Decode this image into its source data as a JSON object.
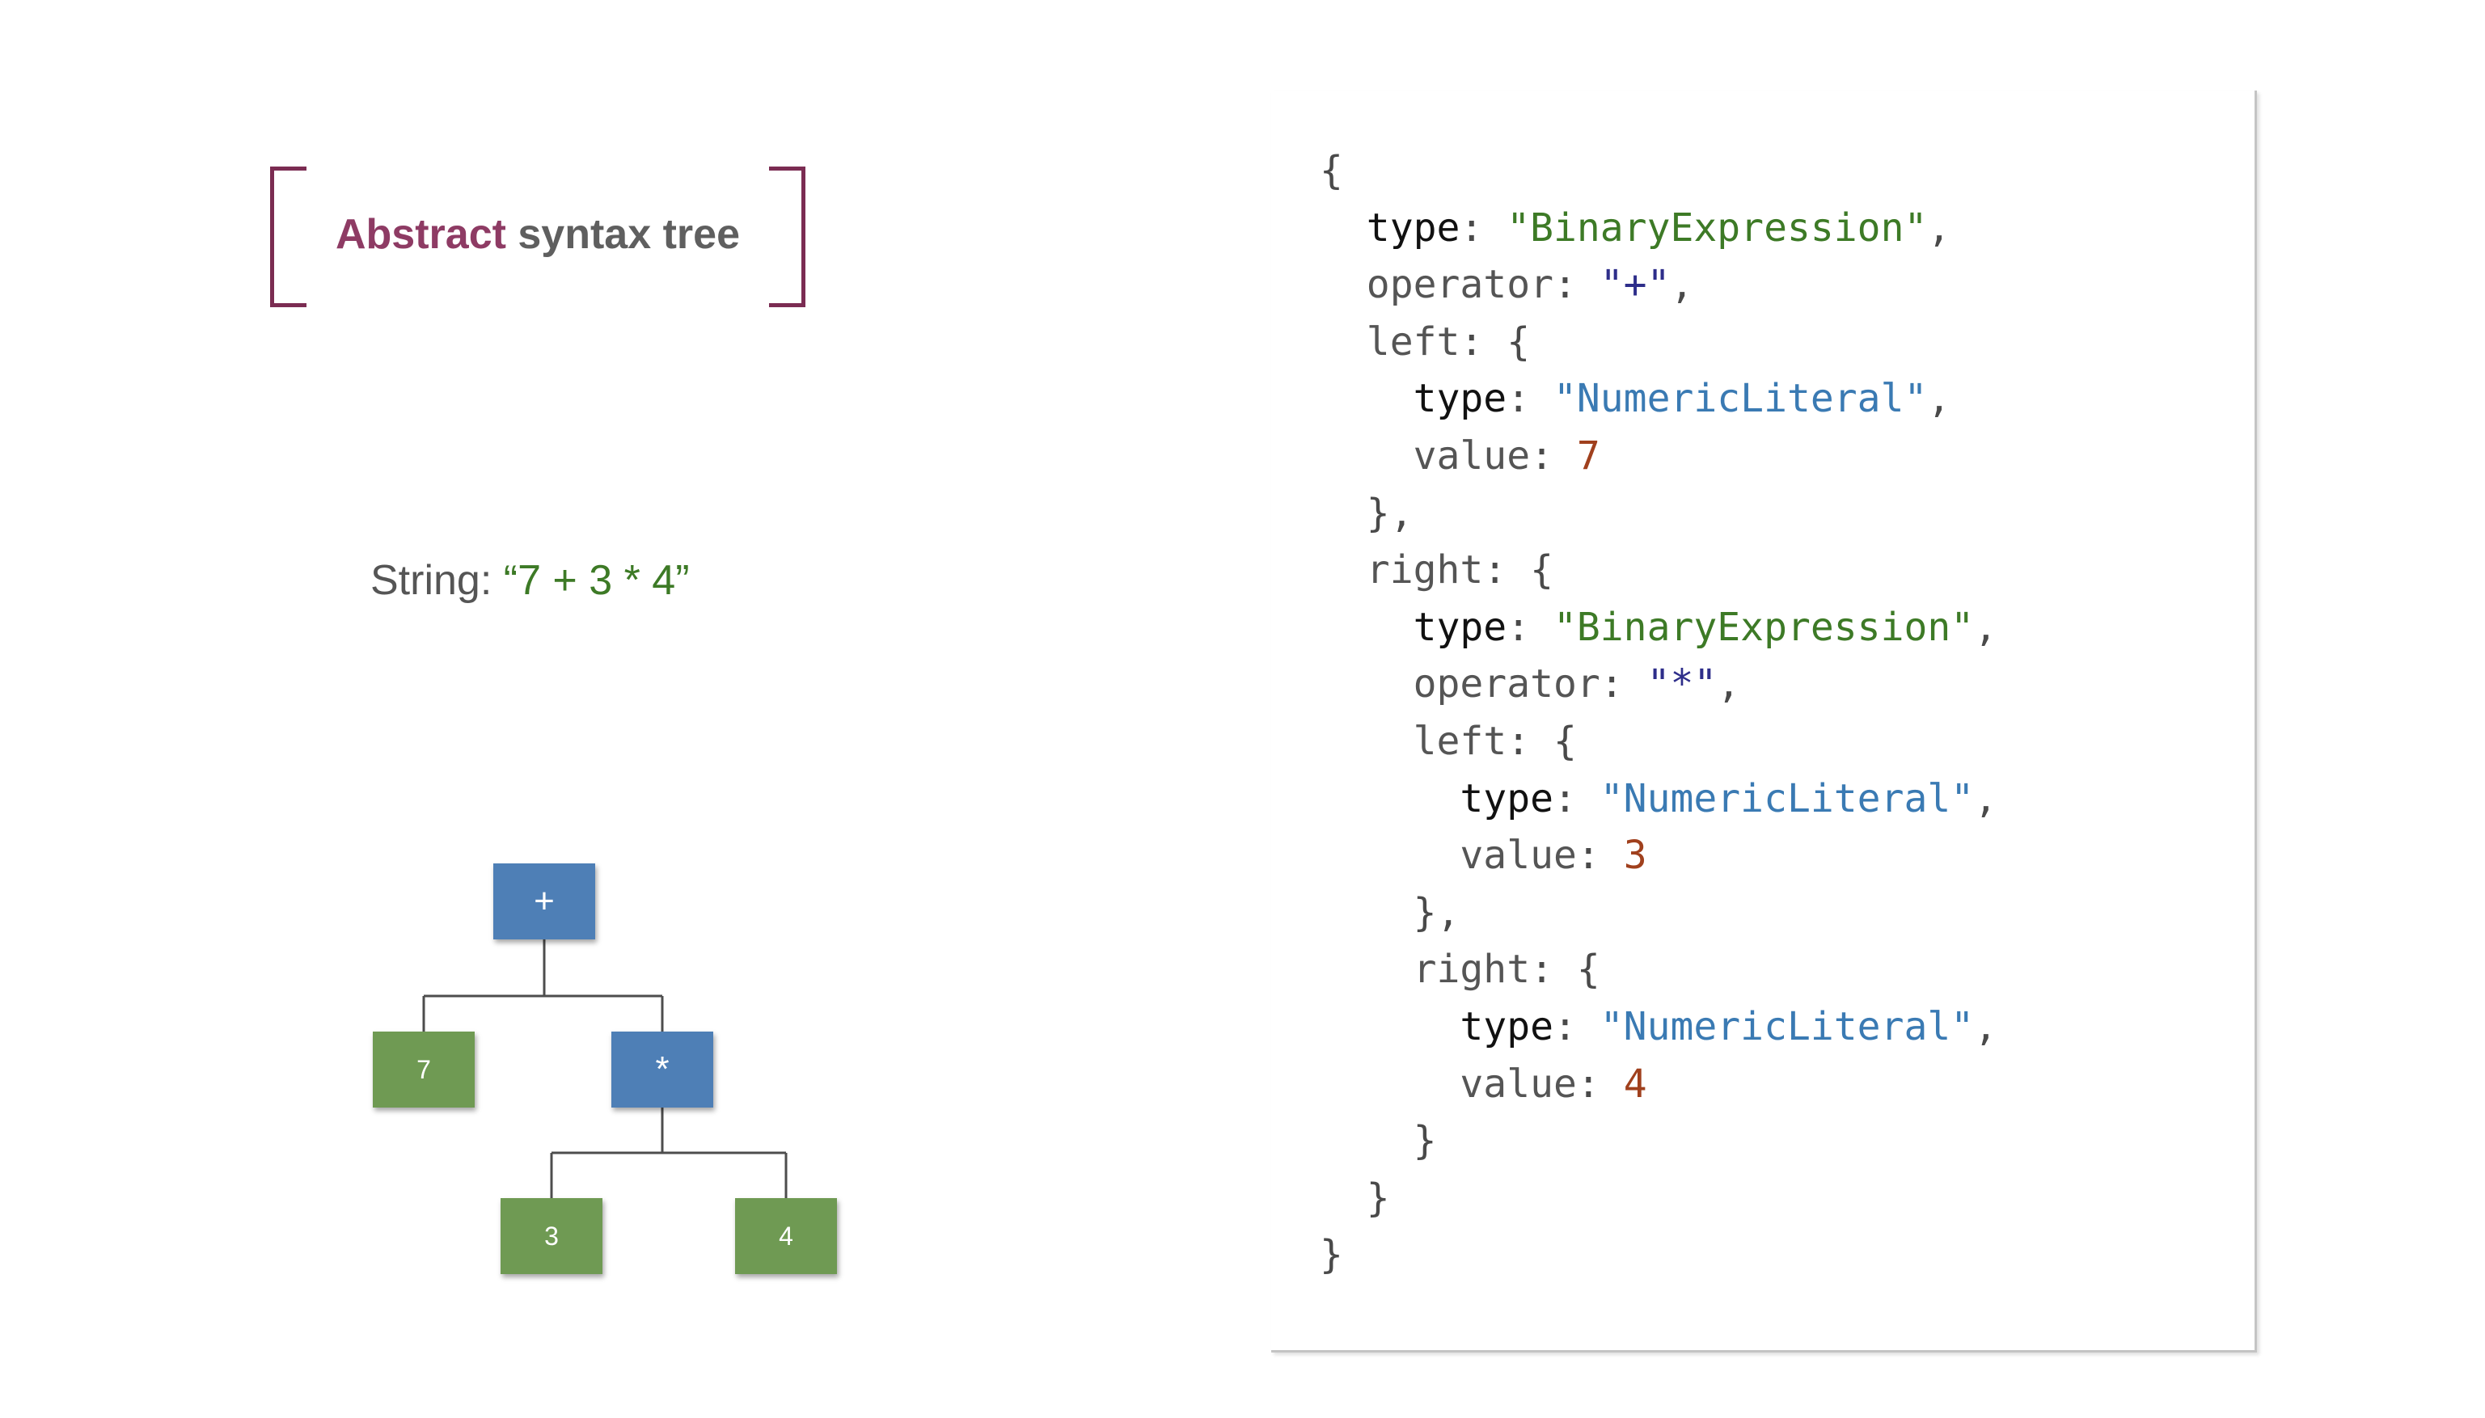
{
  "slide": {
    "title_accent": "Abstract",
    "title_rest": "syntax tree",
    "string_label": "String:",
    "string_value": "“7 + 3 * 4”"
  },
  "tree": {
    "root": "+",
    "left": "7",
    "right": "*",
    "right_left": "3",
    "right_right": "4"
  },
  "code": {
    "open": "{",
    "close": "}",
    "type_key": "type",
    "operator_key": "operator",
    "left_key": "left",
    "right_key": "right",
    "value_key": "value",
    "binary": "\"BinaryExpression\"",
    "numeric": "\"NumericLiteral\"",
    "op_plus": "\"+\"",
    "op_mul": "\"*\"",
    "v7": "7",
    "v3": "3",
    "v4": "4"
  },
  "colors": {
    "accent": "#8e3b64",
    "operator_node": "#4e7fb6",
    "literal_node": "#6f9a53",
    "string_green": "#3d7a26",
    "string_blue": "#3a7ab3",
    "number": "#a0401d"
  }
}
